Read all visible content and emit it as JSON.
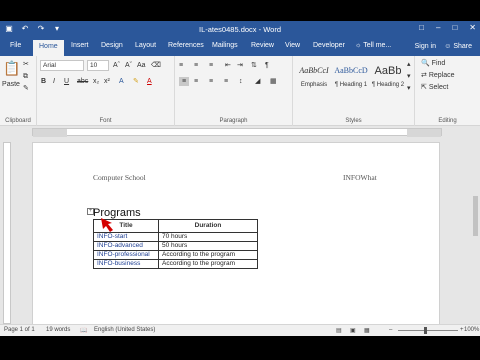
{
  "window": {
    "title": "IL-ates0485.docx - Word"
  },
  "tabs": [
    "File",
    "Home",
    "Insert",
    "Design",
    "Layout",
    "References",
    "Mailings",
    "Review",
    "View",
    "Developer"
  ],
  "tell_me": "Tell me...",
  "sign_in": "Sign in",
  "share": "Share",
  "ribbon": {
    "paste": "Paste",
    "font_name": "Arial",
    "font_size": "10",
    "styles": [
      {
        "sample": "AaBbCcI",
        "name": "Emphasis"
      },
      {
        "sample": "AaBbCcD",
        "name": "¶ Heading 1"
      },
      {
        "sample": "AaBb",
        "name": "¶ Heading 2"
      }
    ],
    "find": "Find",
    "replace": "Replace",
    "select": "Select",
    "groups": {
      "clipboard": "Clipboard",
      "font": "Font",
      "paragraph": "Paragraph",
      "styles": "Styles",
      "editing": "Editing"
    }
  },
  "document": {
    "header_left": "Computer School",
    "header_right": "INFOWhat",
    "heading": "Programs",
    "table": {
      "headers": [
        "Title",
        "Duration"
      ],
      "rows": [
        [
          "INFO-start",
          "70 hours"
        ],
        [
          "INFO-advanced",
          "50 hours"
        ],
        [
          "INFO-professional",
          "According to the program"
        ],
        [
          "INFO-business",
          "According to the program"
        ]
      ]
    }
  },
  "status": {
    "page": "Page 1 of 1",
    "words": "19 words",
    "language": "English (United States)",
    "zoom": "100%"
  }
}
